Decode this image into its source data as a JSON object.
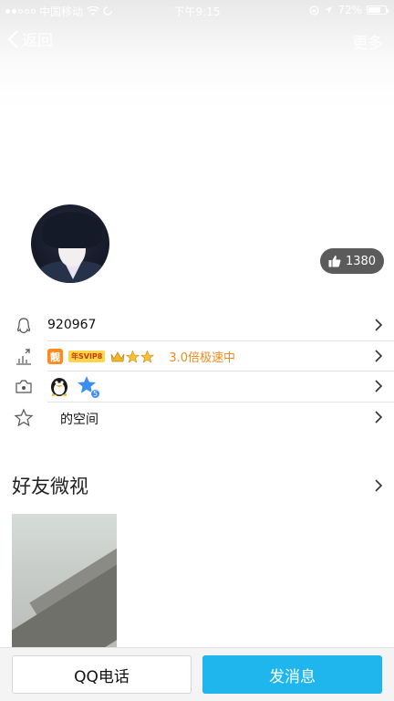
{
  "status_bar": {
    "carrier": "中国移动",
    "time": "下午9:15",
    "battery_percent": "72%",
    "battery_level": 0.72
  },
  "nav": {
    "back_label": "返回",
    "more_label": "更多"
  },
  "profile": {
    "like_count": "1380"
  },
  "info_rows": {
    "qq_number": "920967",
    "speed_text": "3.0倍极速中",
    "badge_liang": "靓",
    "badge_svip": "年SVIP8",
    "star_level_number": "5",
    "space_text": "的空间"
  },
  "section": {
    "title": "好友微视"
  },
  "bottom": {
    "call_label": "QQ电话",
    "message_label": "发消息"
  },
  "colors": {
    "accent_blue": "#1fb6ee",
    "speed_orange": "#f08a1a",
    "like_bg": "#5b5b5b"
  }
}
